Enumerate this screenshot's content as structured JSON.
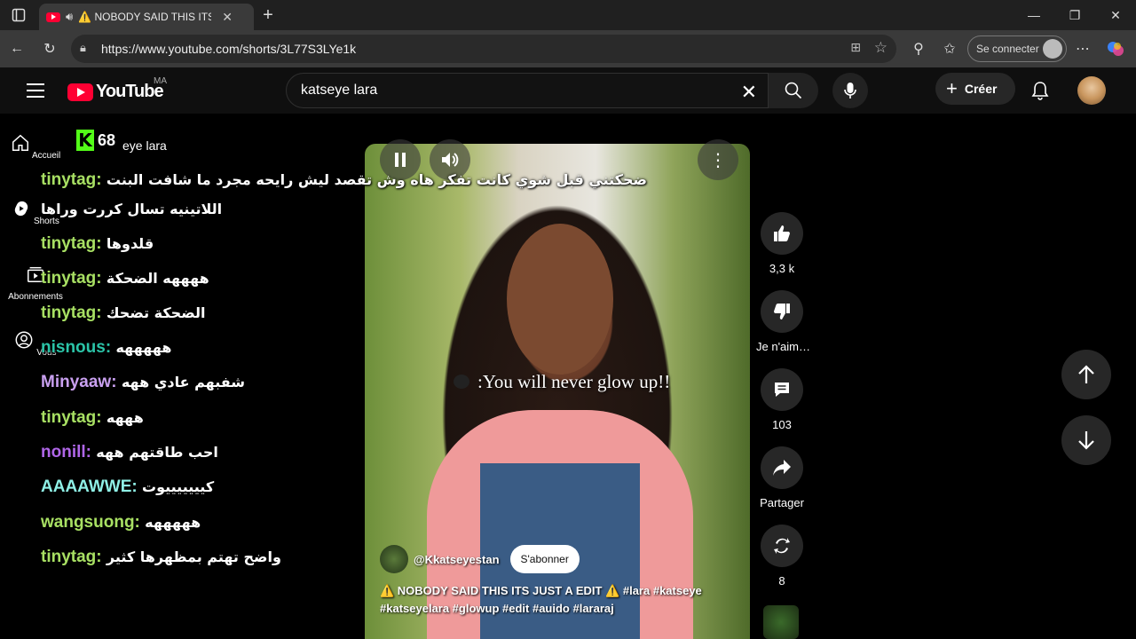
{
  "browser": {
    "tab_title": "⚠️ NOBODY SAID THIS ITS JUST A EDIT",
    "url": "https://www.youtube.com/shorts/3L77S3LYe1k",
    "signin_label": "Se connecter"
  },
  "youtube": {
    "logo_text": "YouTube",
    "country_code": "MA",
    "search_value": "katseye lara",
    "create_label": "Créer"
  },
  "sidebar": {
    "items": [
      {
        "label": "Accueil",
        "icon": "home-icon"
      },
      {
        "label": "Shorts",
        "icon": "shorts-icon"
      },
      {
        "label": "Abonnements",
        "icon": "subscriptions-icon"
      },
      {
        "label": "Vous",
        "icon": "user-icon"
      }
    ]
  },
  "overlay": {
    "kick_letter": "K",
    "viewer_count": "68",
    "partial_text": "eye lara"
  },
  "chat": {
    "messages": [
      {
        "nick": "tinytag:",
        "color": "#a8e063",
        "text": "ضحكتني قبل شوي كانت تفكر هاه وش تقصد ليش رايحه مجرد ما شافت البنت"
      },
      {
        "continuation": "اللاتينيه تسال كررت وراها"
      },
      {
        "nick": "tinytag:",
        "color": "#a8e063",
        "text": "قلدوها"
      },
      {
        "nick": "tinytag:",
        "color": "#a8e063",
        "text": "ههههه الضحكة"
      },
      {
        "nick": "tinytag:",
        "color": "#a8e063",
        "text": "الضحكة تضحك"
      },
      {
        "nick": "nisnous:",
        "color": "#2bc4a8",
        "text": "هههههه"
      },
      {
        "nick": "Minyaaw:",
        "color": "#c9a0f0",
        "text": "شفبهم عادي ههه"
      },
      {
        "nick": "tinytag:",
        "color": "#a8e063",
        "text": "هههه"
      },
      {
        "nick": "nonill:",
        "color": "#b066e8",
        "text": "احب طاقتهم ههه"
      },
      {
        "nick": "AAAAWWE:",
        "color": "#8ff0e6",
        "text": "كيييييييوت"
      },
      {
        "nick": "wangsuong:",
        "color": "#a8e063",
        "text": "هههههه"
      },
      {
        "nick": "tinytag:",
        "color": "#a8e063",
        "text": "واضح تهتم بمظهرها كثير"
      }
    ]
  },
  "video": {
    "subtitle": ":You will never glow up!!",
    "channel": "@Kkatseyestan",
    "subscribe_label": "S'abonner",
    "description": "⚠️ NOBODY SAID THIS ITS JUST A EDIT ⚠️ #lara #katseye #katseyelara #glowup #edit #auido #lararaj"
  },
  "actions": {
    "like_count": "3,3 k",
    "dislike_label": "Je n'aim…",
    "comment_count": "103",
    "share_label": "Partager",
    "remix_count": "8"
  }
}
